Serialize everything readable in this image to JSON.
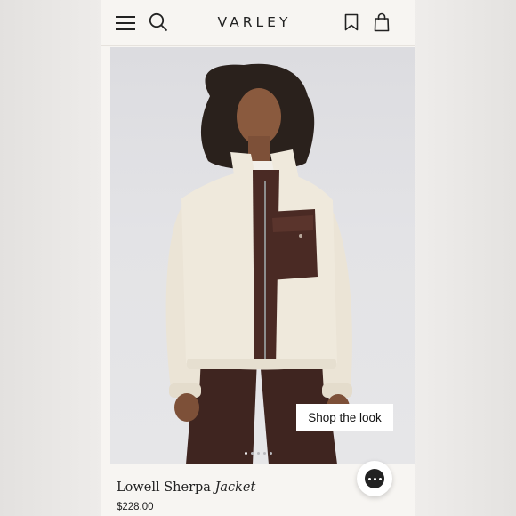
{
  "header": {
    "logo": "VARLEY",
    "icons": [
      "menu-icon",
      "search-icon",
      "bookmark-icon",
      "bag-icon"
    ]
  },
  "hero": {
    "image_description_icon": "product-photo",
    "shop_the_look_label": "Shop the look",
    "carousel_dots": 5,
    "carousel_active_index": 0
  },
  "product": {
    "title_main": "Lowell Sherpa",
    "title_italic": "Jacket",
    "price": "$228.00"
  },
  "chat": {
    "icon": "chat-icon"
  },
  "colors": {
    "background": "#f7f5f2",
    "text": "#222222",
    "jacket_cream": "#efe9dc",
    "jacket_brown": "#4a2a24"
  }
}
